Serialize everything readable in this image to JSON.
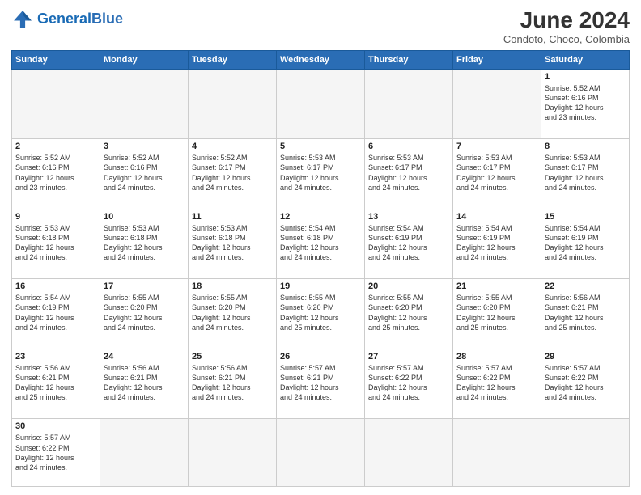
{
  "header": {
    "logo_general": "General",
    "logo_blue": "Blue",
    "month_year": "June 2024",
    "location": "Condoto, Choco, Colombia"
  },
  "weekdays": [
    "Sunday",
    "Monday",
    "Tuesday",
    "Wednesday",
    "Thursday",
    "Friday",
    "Saturday"
  ],
  "weeks": [
    [
      {
        "day": "",
        "info": "",
        "empty": true
      },
      {
        "day": "",
        "info": "",
        "empty": true
      },
      {
        "day": "",
        "info": "",
        "empty": true
      },
      {
        "day": "",
        "info": "",
        "empty": true
      },
      {
        "day": "",
        "info": "",
        "empty": true
      },
      {
        "day": "",
        "info": "",
        "empty": true
      },
      {
        "day": "1",
        "info": "Sunrise: 5:52 AM\nSunset: 6:16 PM\nDaylight: 12 hours\nand 23 minutes."
      }
    ],
    [
      {
        "day": "2",
        "info": "Sunrise: 5:52 AM\nSunset: 6:16 PM\nDaylight: 12 hours\nand 23 minutes."
      },
      {
        "day": "3",
        "info": "Sunrise: 5:52 AM\nSunset: 6:16 PM\nDaylight: 12 hours\nand 24 minutes."
      },
      {
        "day": "4",
        "info": "Sunrise: 5:52 AM\nSunset: 6:17 PM\nDaylight: 12 hours\nand 24 minutes."
      },
      {
        "day": "5",
        "info": "Sunrise: 5:53 AM\nSunset: 6:17 PM\nDaylight: 12 hours\nand 24 minutes."
      },
      {
        "day": "6",
        "info": "Sunrise: 5:53 AM\nSunset: 6:17 PM\nDaylight: 12 hours\nand 24 minutes."
      },
      {
        "day": "7",
        "info": "Sunrise: 5:53 AM\nSunset: 6:17 PM\nDaylight: 12 hours\nand 24 minutes."
      },
      {
        "day": "8",
        "info": "Sunrise: 5:53 AM\nSunset: 6:17 PM\nDaylight: 12 hours\nand 24 minutes."
      }
    ],
    [
      {
        "day": "9",
        "info": "Sunrise: 5:53 AM\nSunset: 6:18 PM\nDaylight: 12 hours\nand 24 minutes."
      },
      {
        "day": "10",
        "info": "Sunrise: 5:53 AM\nSunset: 6:18 PM\nDaylight: 12 hours\nand 24 minutes."
      },
      {
        "day": "11",
        "info": "Sunrise: 5:53 AM\nSunset: 6:18 PM\nDaylight: 12 hours\nand 24 minutes."
      },
      {
        "day": "12",
        "info": "Sunrise: 5:54 AM\nSunset: 6:18 PM\nDaylight: 12 hours\nand 24 minutes."
      },
      {
        "day": "13",
        "info": "Sunrise: 5:54 AM\nSunset: 6:19 PM\nDaylight: 12 hours\nand 24 minutes."
      },
      {
        "day": "14",
        "info": "Sunrise: 5:54 AM\nSunset: 6:19 PM\nDaylight: 12 hours\nand 24 minutes."
      },
      {
        "day": "15",
        "info": "Sunrise: 5:54 AM\nSunset: 6:19 PM\nDaylight: 12 hours\nand 24 minutes."
      }
    ],
    [
      {
        "day": "16",
        "info": "Sunrise: 5:54 AM\nSunset: 6:19 PM\nDaylight: 12 hours\nand 24 minutes."
      },
      {
        "day": "17",
        "info": "Sunrise: 5:55 AM\nSunset: 6:20 PM\nDaylight: 12 hours\nand 24 minutes."
      },
      {
        "day": "18",
        "info": "Sunrise: 5:55 AM\nSunset: 6:20 PM\nDaylight: 12 hours\nand 24 minutes."
      },
      {
        "day": "19",
        "info": "Sunrise: 5:55 AM\nSunset: 6:20 PM\nDaylight: 12 hours\nand 25 minutes."
      },
      {
        "day": "20",
        "info": "Sunrise: 5:55 AM\nSunset: 6:20 PM\nDaylight: 12 hours\nand 25 minutes."
      },
      {
        "day": "21",
        "info": "Sunrise: 5:55 AM\nSunset: 6:20 PM\nDaylight: 12 hours\nand 25 minutes."
      },
      {
        "day": "22",
        "info": "Sunrise: 5:56 AM\nSunset: 6:21 PM\nDaylight: 12 hours\nand 25 minutes."
      }
    ],
    [
      {
        "day": "23",
        "info": "Sunrise: 5:56 AM\nSunset: 6:21 PM\nDaylight: 12 hours\nand 25 minutes."
      },
      {
        "day": "24",
        "info": "Sunrise: 5:56 AM\nSunset: 6:21 PM\nDaylight: 12 hours\nand 24 minutes."
      },
      {
        "day": "25",
        "info": "Sunrise: 5:56 AM\nSunset: 6:21 PM\nDaylight: 12 hours\nand 24 minutes."
      },
      {
        "day": "26",
        "info": "Sunrise: 5:57 AM\nSunset: 6:21 PM\nDaylight: 12 hours\nand 24 minutes."
      },
      {
        "day": "27",
        "info": "Sunrise: 5:57 AM\nSunset: 6:22 PM\nDaylight: 12 hours\nand 24 minutes."
      },
      {
        "day": "28",
        "info": "Sunrise: 5:57 AM\nSunset: 6:22 PM\nDaylight: 12 hours\nand 24 minutes."
      },
      {
        "day": "29",
        "info": "Sunrise: 5:57 AM\nSunset: 6:22 PM\nDaylight: 12 hours\nand 24 minutes."
      }
    ],
    [
      {
        "day": "30",
        "info": "Sunrise: 5:57 AM\nSunset: 6:22 PM\nDaylight: 12 hours\nand 24 minutes."
      },
      {
        "day": "",
        "info": "",
        "empty": true
      },
      {
        "day": "",
        "info": "",
        "empty": true
      },
      {
        "day": "",
        "info": "",
        "empty": true
      },
      {
        "day": "",
        "info": "",
        "empty": true
      },
      {
        "day": "",
        "info": "",
        "empty": true
      },
      {
        "day": "",
        "info": "",
        "empty": true
      }
    ]
  ]
}
